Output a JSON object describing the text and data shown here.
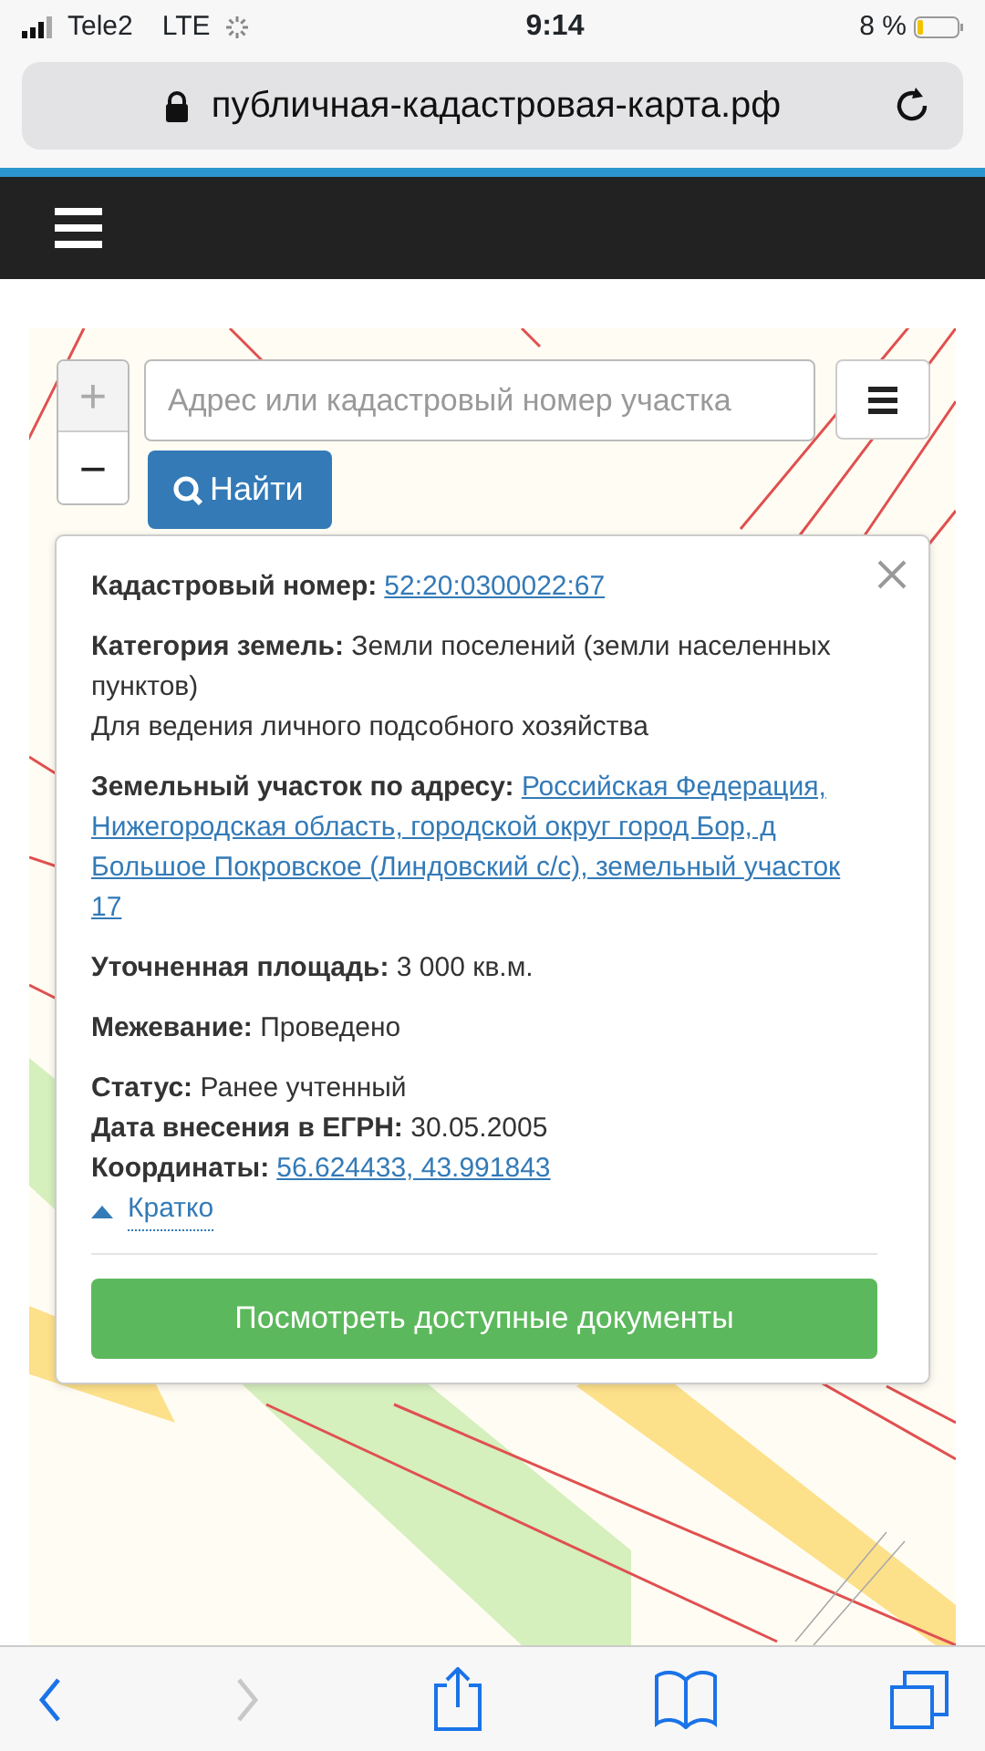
{
  "status_bar": {
    "carrier": "Tele2",
    "network": "LTE",
    "time": "9:14",
    "battery": "8 %"
  },
  "address_bar": {
    "url": "публичная-кадастровая-карта.рф",
    "secure": true
  },
  "map": {
    "kind": "picture"
  },
  "search": {
    "placeholder": "Адрес или кадастровый номер участка",
    "button": "Найти"
  },
  "zoom": [
    "+",
    "−"
  ],
  "info_popup": {
    "sections": [
      [
        {
          "kind": "link",
          "label": "Кадастровый номер:",
          "value": "52:20:0300022:67"
        }
      ],
      [
        {
          "kind": "text",
          "label": "Категория земель:",
          "value": "Земли поселений (земли населенных пунктов)"
        },
        {
          "kind": "plain",
          "value": "Для ведения личного подсобного хозяйства"
        }
      ],
      [
        {
          "kind": "address",
          "label": "Земельный участок по адресу:",
          "value": "Российская Федерация, Нижегородская область, городской округ город Бор, д Большое Покровское (Линдовский с/с), земельный участок 17"
        }
      ],
      [
        {
          "kind": "text",
          "label": "Уточненная площадь:",
          "value": "3 000 кв.м."
        }
      ],
      [
        {
          "kind": "text",
          "label": "Межевание:",
          "value": "Проведено"
        }
      ],
      [
        {
          "kind": "text",
          "label": "Статус:",
          "value": "Ранее учтенный"
        },
        {
          "kind": "text",
          "label": "Дата внесения в ЕГРН:",
          "value": "30.05.2005"
        },
        {
          "kind": "coords",
          "label": "Координаты:",
          "value": "56.624433, 43.991843"
        }
      ]
    ],
    "collapse_link": "Кратко",
    "documents_button": "Посмотреть доступные документы"
  },
  "toolbar": [
    {
      "kind": "back",
      "disabled": false
    },
    {
      "kind": "forward",
      "disabled": true
    },
    {
      "kind": "share",
      "disabled": false
    },
    {
      "kind": "bookmarks",
      "disabled": false
    },
    {
      "kind": "tabs",
      "disabled": false
    }
  ]
}
